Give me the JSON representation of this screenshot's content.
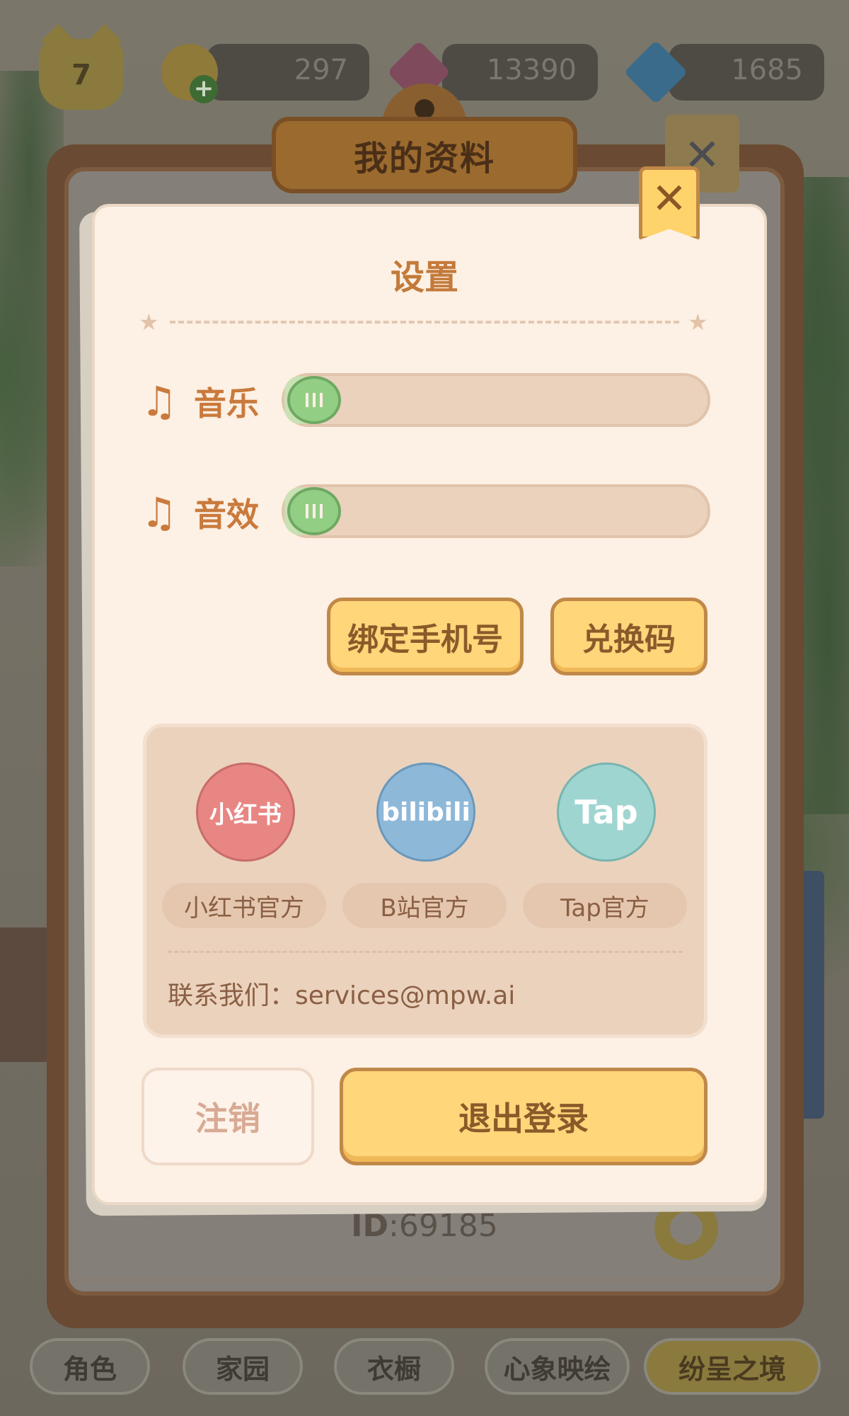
{
  "top_bar": {
    "level": "7",
    "bells": "297",
    "gems": "13390",
    "snowflakes": "1685"
  },
  "profile": {
    "title": "我的资料",
    "id_label": "ID",
    "id_value": ":69185"
  },
  "settings": {
    "title": "设置",
    "music_label": "音乐",
    "music_volume": 0.0,
    "sfx_label": "音效",
    "sfx_volume": 0.0,
    "bind_phone_label": "绑定手机号",
    "redeem_code_label": "兑换码",
    "social": [
      {
        "icon_text": "小红书",
        "label": "小红书官方"
      },
      {
        "icon_text": "bilibili",
        "label": "B站官方"
      },
      {
        "icon_text": "Tap",
        "label": "Tap官方"
      }
    ],
    "contact": "联系我们：services@mpw.ai",
    "cancel_account_label": "注销",
    "logout_label": "退出登录"
  },
  "bottom_nav": [
    {
      "label": "角色"
    },
    {
      "label": "家园"
    },
    {
      "label": "衣橱"
    },
    {
      "label": "心象映绘"
    },
    {
      "label": "纷呈之境"
    }
  ],
  "colors": {
    "accent": "#c97a3c",
    "button_yellow": "#ffd67a",
    "slider_knob": "#92cf85"
  }
}
